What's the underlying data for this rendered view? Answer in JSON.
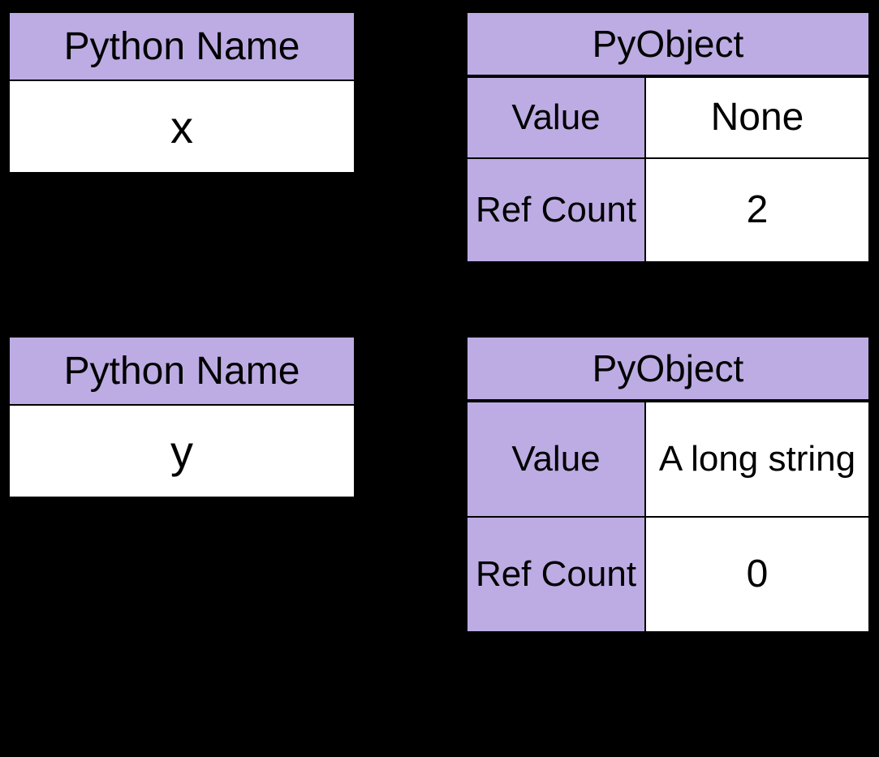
{
  "name1": {
    "header": "Python Name",
    "value": "x"
  },
  "name2": {
    "header": "Python Name",
    "value": "y"
  },
  "obj1": {
    "header": "PyObject",
    "value_label": "Value",
    "value": "None",
    "refcount_label": "Ref Count",
    "refcount": "2"
  },
  "obj2": {
    "header": "PyObject",
    "value_label": "Value",
    "value": "A long string",
    "refcount_label": "Ref Count",
    "refcount": "0"
  }
}
